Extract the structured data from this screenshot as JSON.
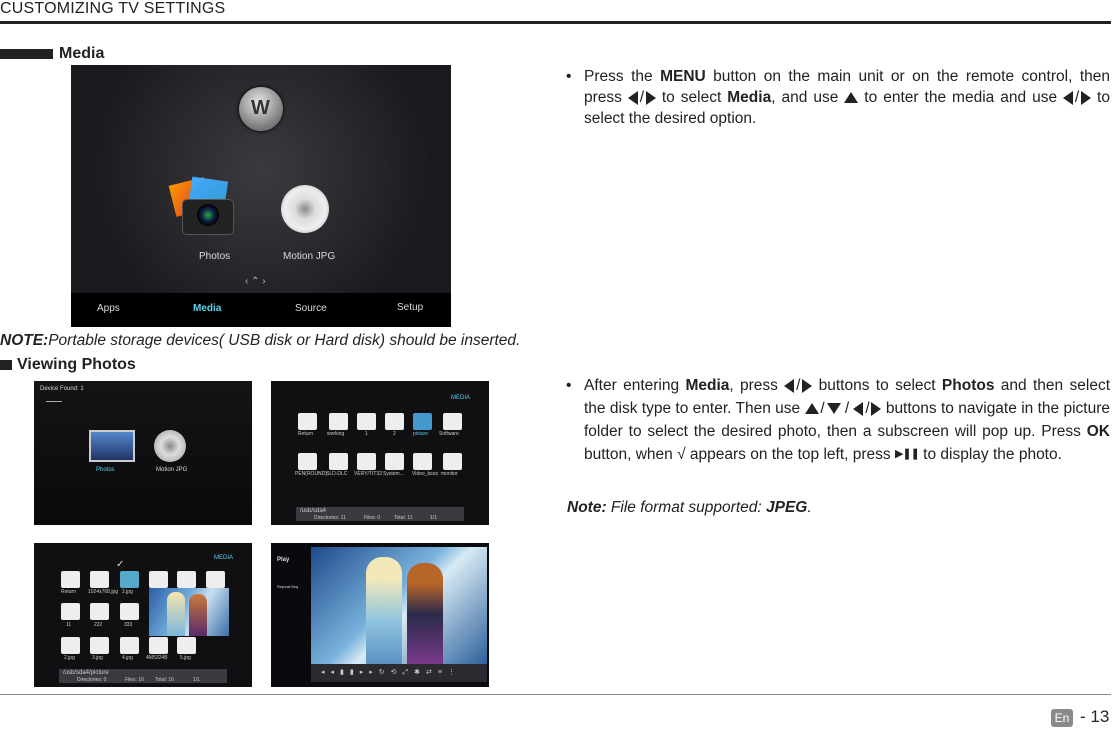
{
  "header": {
    "title": "CUSTOMIZING TV SETTINGS"
  },
  "section_media": {
    "title": "Media"
  },
  "media_screen": {
    "items": [
      "Photos",
      "Motion JPG"
    ],
    "menu": [
      "Apps",
      "Media",
      "Source",
      "Setup"
    ],
    "active_menu": "Media"
  },
  "para1": {
    "bullet": "•",
    "t1": "Press the ",
    "menu_key": "MENU",
    "t2": " button on the main unit or on the remote control, then press ",
    "t3": " to select ",
    "media_word": "Media",
    "t4": ", and use ",
    "t5": " to enter the media and use ",
    "t6": " to select the desired option."
  },
  "note1": {
    "label": "NOTE:",
    "text": "Portable storage devices( USB disk or Hard disk) should be inserted."
  },
  "section_photos": {
    "title": "Viewing Photos"
  },
  "shot1": {
    "device_found": "Device Found: 1",
    "items": [
      "Photos",
      "Motion JPG"
    ]
  },
  "shot2": {
    "media": "MEDIA",
    "row1": [
      "Return",
      "working",
      "1",
      "2",
      "picture",
      "Software"
    ],
    "row2": [
      "PEN(ROUND)",
      "SLD-DLC",
      "VERY/TIT32",
      "System...",
      "Video_bsos",
      "monitor"
    ],
    "path": "/usb/sda4",
    "status": [
      "Directories: 11",
      "Files: 0",
      "Total: 11",
      "1/1"
    ]
  },
  "shot3": {
    "media": "MEDIA",
    "row1": [
      "Return",
      "1024x768.jpg",
      "2.jpg",
      "",
      "",
      ""
    ],
    "row2": [
      "11",
      "222",
      "333",
      "",
      "",
      ""
    ],
    "row3": [
      "2.jpg",
      "3.jpg",
      "4.jpg",
      "4M5324B",
      "5.jpg"
    ],
    "path": "/usb/sda4/picture",
    "status": [
      "Directories: 0",
      "Files: 16",
      "Total: 16",
      "1/1"
    ]
  },
  "shot4": {
    "play": "Play",
    "repeat": "Repeat:Seq"
  },
  "para2": {
    "bullet": "•",
    "t1": "After entering ",
    "media_word": "Media",
    "t2": ", press ",
    "t3": " buttons to select ",
    "photos_word": "Photos",
    "t4": " and then select the disk type to enter. Then use ",
    "t5": " / ",
    "t6": " buttons to navigate in the picture folder to select the desired photo, then a subscreen will pop up. Press ",
    "ok_key": "OK",
    "t7": " button, when √ appears on the top left, press ",
    "t8": " to display the photo."
  },
  "note2": {
    "label": "Note:",
    "text": " File format supported: ",
    "format": "JPEG",
    "end": "."
  },
  "footer": {
    "lang": "En",
    "page": "- 13"
  }
}
